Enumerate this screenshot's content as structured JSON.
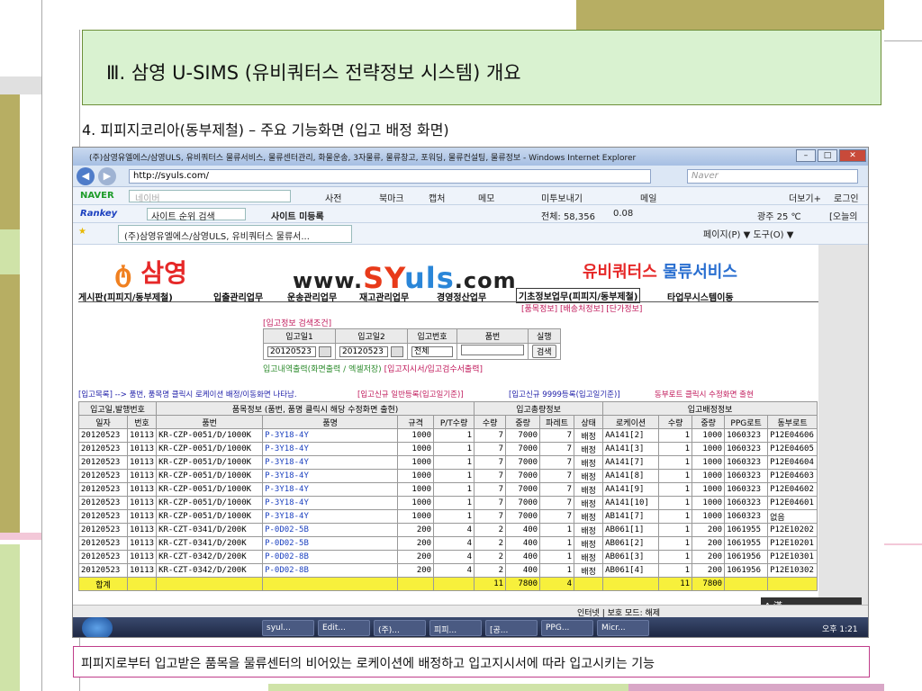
{
  "title": "Ⅲ. 삼영 U-SIMS (유비쿼터스 전략정보 시스템) 개요",
  "subtitle": "4. 피피지코리아(동부제철) – 주요 기능화면 (입고 배정 화면)",
  "caption": "피피지로부터 입고받은 품목을 물류센터의 비어있는 로케이션에 배정하고 입고지시서에 따라 입고시키는 기능",
  "browser": {
    "window_title": "(주)삼영유엘에스/삼영ULS, 유비쿼터스 물류서비스, 물류센터관리, 화물운송, 3자물류, 물류창고, 포워딩, 물류컨설팅, 물류정보 - Windows Internet Explorer",
    "url": "http://syuls.com/",
    "search_placeholder": "Naver",
    "naver_bar": {
      "brand": "NAVER",
      "search_placeholder": "네이버",
      "dict": "사전",
      "bookmark": "북마크",
      "capture": "캡처",
      "memo": "메모",
      "preview": "미투보내기",
      "mail": "메일",
      "more": "더보기+",
      "login": "로그인"
    },
    "rankey_bar": {
      "brand": "Rankey",
      "search": "사이트 순위 검색",
      "register": "사이트 미등록",
      "total": "전체: 58,356",
      "val": "0.08",
      "weather": "광주 25 ℃",
      "today": "[오늘의"
    },
    "tab": "(주)삼영유엘에스/삼영ULS, 유비쿼터스 물류서...",
    "commands": "페이지(P) ▼  도구(O) ▼",
    "status": "인터넷 | 보호 모드: 해제",
    "ime": "A 漢"
  },
  "site": {
    "logo": "삼영",
    "www_pre": "www.",
    "www_sy": "SY",
    "www_uls": "uls",
    "www_post": ".com",
    "ubq_1": "유비쿼터스",
    "ubq_2": "물류서비스",
    "menu": [
      "게시판(피피지/동부제철)",
      "입출관리업무",
      "운송관리업무",
      "재고관리업무",
      "경영정산업무",
      "기초정보업무(피피지/동부제철)",
      "타업무시스템이동"
    ],
    "submenu": "[품목정보]  [배송처정보]  [단가정보]",
    "search_label": "[입고정보 검색조건]",
    "search_headers": [
      "입고일1",
      "입고일2",
      "입고번호",
      "품번",
      "실행"
    ],
    "date1": "20120523",
    "date2": "20120523",
    "in_no": "전체",
    "search_btn": "검색",
    "output_a": "입고내역출력(화면출력 / 엑셀저장)",
    "output_b": "[입고지시서/입고검수서출력]",
    "note_1": "[입고목록] --> 품번, 품목명 클릭시 로케이션 배정/이동화면 나타남.",
    "note_2": "[입고신규 일반등록(입고일기준)]",
    "note_3": "[입고신규 9999등록(입고일기준)]",
    "note_4": "동부로트 클릭시 수정화면 출현"
  },
  "table": {
    "group_headers": [
      "입고일,발행번호",
      "품목정보 (품번, 품명 클릭시 해당 수정화면 출현)",
      "입고총량정보",
      "입고배정정보"
    ],
    "headers": [
      "일자",
      "번호",
      "품번",
      "품명",
      "규격",
      "P/T수량",
      "수량",
      "중량",
      "파레트",
      "상태",
      "로케이션",
      "수량",
      "중량",
      "PPG로트",
      "동부로트"
    ],
    "rows": [
      [
        "20120523",
        "10113",
        "KR-CZP-0051/D/1000K",
        "P-3Y18-4Y",
        "1000",
        "1",
        "7",
        "7000",
        "7",
        "배정",
        "AA141[2]",
        "1",
        "1000",
        "1060323",
        "P12E04606"
      ],
      [
        "20120523",
        "10113",
        "KR-CZP-0051/D/1000K",
        "P-3Y18-4Y",
        "1000",
        "1",
        "7",
        "7000",
        "7",
        "배정",
        "AA141[3]",
        "1",
        "1000",
        "1060323",
        "P12E04605"
      ],
      [
        "20120523",
        "10113",
        "KR-CZP-0051/D/1000K",
        "P-3Y18-4Y",
        "1000",
        "1",
        "7",
        "7000",
        "7",
        "배정",
        "AA141[7]",
        "1",
        "1000",
        "1060323",
        "P12E04604"
      ],
      [
        "20120523",
        "10113",
        "KR-CZP-0051/D/1000K",
        "P-3Y18-4Y",
        "1000",
        "1",
        "7",
        "7000",
        "7",
        "배정",
        "AA141[8]",
        "1",
        "1000",
        "1060323",
        "P12E04603"
      ],
      [
        "20120523",
        "10113",
        "KR-CZP-0051/D/1000K",
        "P-3Y18-4Y",
        "1000",
        "1",
        "7",
        "7000",
        "7",
        "배정",
        "AA141[9]",
        "1",
        "1000",
        "1060323",
        "P12E04602"
      ],
      [
        "20120523",
        "10113",
        "KR-CZP-0051/D/1000K",
        "P-3Y18-4Y",
        "1000",
        "1",
        "7",
        "7000",
        "7",
        "배정",
        "AA141[10]",
        "1",
        "1000",
        "1060323",
        "P12E04601"
      ],
      [
        "20120523",
        "10113",
        "KR-CZP-0051/D/1000K",
        "P-3Y18-4Y",
        "1000",
        "1",
        "7",
        "7000",
        "7",
        "배정",
        "AB141[7]",
        "1",
        "1000",
        "1060323",
        "없음"
      ],
      [
        "20120523",
        "10113",
        "KR-CZT-0341/D/200K",
        "P-0D02-5B",
        "200",
        "4",
        "2",
        "400",
        "1",
        "배정",
        "AB061[1]",
        "1",
        "200",
        "1061955",
        "P12E10202"
      ],
      [
        "20120523",
        "10113",
        "KR-CZT-0341/D/200K",
        "P-0D02-5B",
        "200",
        "4",
        "2",
        "400",
        "1",
        "배정",
        "AB061[2]",
        "1",
        "200",
        "1061955",
        "P12E10201"
      ],
      [
        "20120523",
        "10113",
        "KR-CZT-0342/D/200K",
        "P-0D02-8B",
        "200",
        "4",
        "2",
        "400",
        "1",
        "배정",
        "AB061[3]",
        "1",
        "200",
        "1061956",
        "P12E10301"
      ],
      [
        "20120523",
        "10113",
        "KR-CZT-0342/D/200K",
        "P-0D02-8B",
        "200",
        "4",
        "2",
        "400",
        "1",
        "배정",
        "AB061[4]",
        "1",
        "200",
        "1061956",
        "P12E10302"
      ]
    ],
    "sum": {
      "label": "합계",
      "qty": "11",
      "weight": "7800",
      "pallet": "4",
      "a_qty": "11",
      "a_weight": "7800"
    }
  },
  "taskbar": [
    "syul...",
    "Edit...",
    "(주)...",
    "피피...",
    "[공...",
    "PPG...",
    "Micr..."
  ],
  "clock": "오후 1:21",
  "colors": {
    "title_bg": "#d9f2d0",
    "accent_red": "#e62828",
    "caption_border": "#c03d8a"
  }
}
